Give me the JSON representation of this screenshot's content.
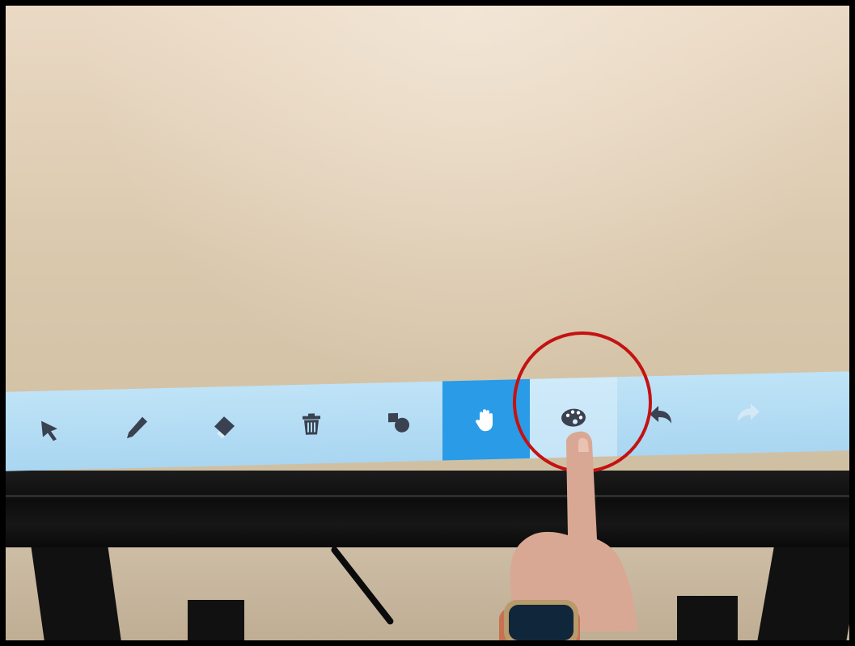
{
  "toolbar": {
    "items": [
      {
        "id": "select",
        "icon": "pointer-arrow-icon",
        "active": false
      },
      {
        "id": "pen",
        "icon": "pen-icon",
        "active": false
      },
      {
        "id": "eraser",
        "icon": "eraser-icon",
        "active": false
      },
      {
        "id": "delete",
        "icon": "trash-icon",
        "active": false
      },
      {
        "id": "shapes",
        "icon": "shapes-icon",
        "active": false
      },
      {
        "id": "pan",
        "icon": "hand-icon",
        "active": true
      },
      {
        "id": "color",
        "icon": "palette-icon",
        "active": false
      },
      {
        "id": "undo",
        "icon": "undo-icon",
        "active": false
      },
      {
        "id": "redo",
        "icon": "redo-icon",
        "active": false,
        "disabled": true
      }
    ],
    "colors": {
      "bar": "#b4dcf4",
      "active": "#2a9be6",
      "icon": "#3a4150",
      "icon_disabled": "#b9d6ea"
    }
  },
  "annotation": {
    "color": "#c41212",
    "target": "palette-icon"
  }
}
